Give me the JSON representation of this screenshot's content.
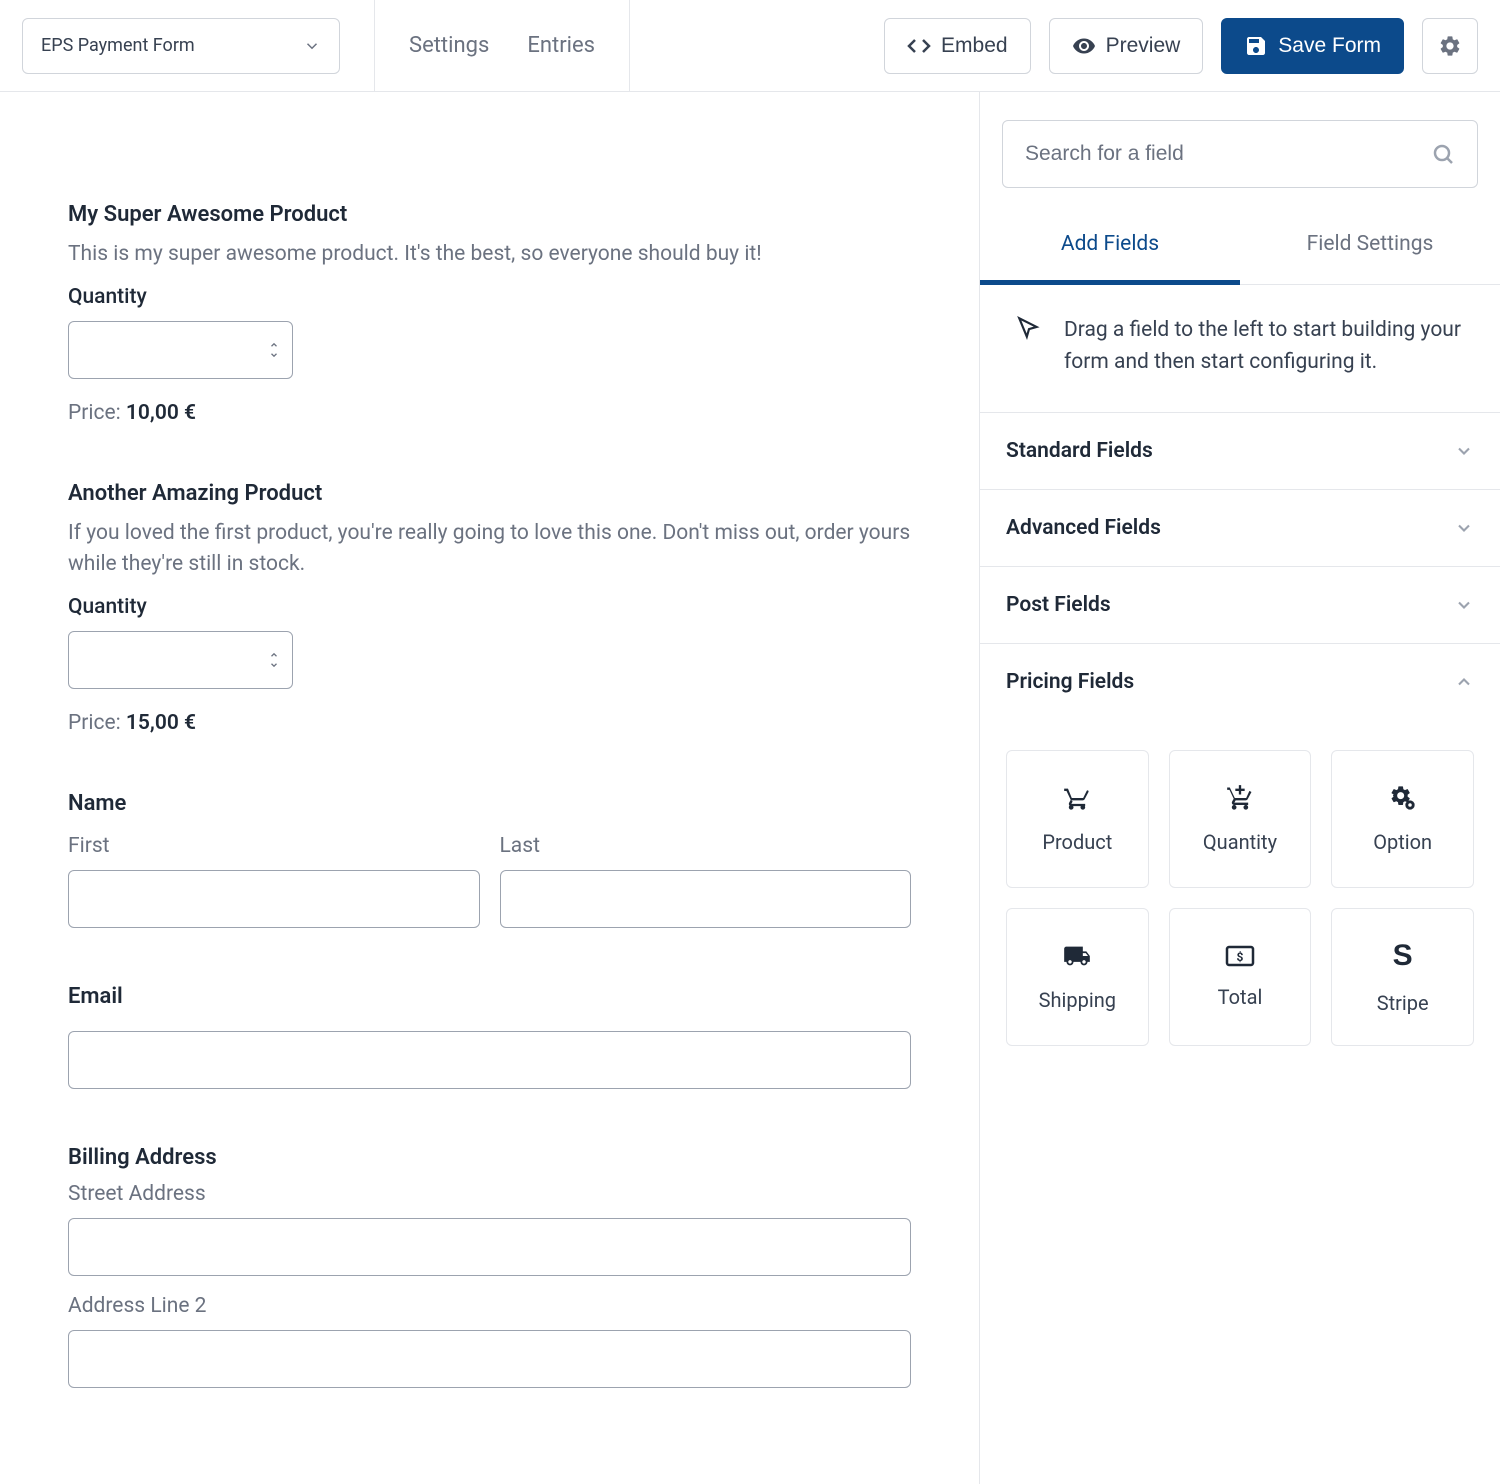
{
  "header": {
    "form_name": "EPS Payment Form",
    "nav": {
      "settings": "Settings",
      "entries": "Entries"
    },
    "buttons": {
      "embed": "Embed",
      "preview": "Preview",
      "save": "Save Form"
    }
  },
  "canvas": {
    "product1": {
      "title": "My Super Awesome Product",
      "desc": "This is my super awesome product. It's the best, so everyone should buy it!",
      "qty_label": "Quantity",
      "price_label": "Price: ",
      "price_value": "10,00 €"
    },
    "product2": {
      "title": "Another Amazing Product",
      "desc": "If you loved the first product, you're really going to love this one. Don't miss out, order yours while they're still in stock.",
      "qty_label": "Quantity",
      "price_label": "Price: ",
      "price_value": "15,00 €"
    },
    "name": {
      "label": "Name",
      "first": "First",
      "last": "Last"
    },
    "email": {
      "label": "Email"
    },
    "billing": {
      "label": "Billing Address",
      "street": "Street Address",
      "line2": "Address Line 2"
    }
  },
  "sidebar": {
    "search_placeholder": "Search for a field",
    "tabs": {
      "add": "Add Fields",
      "settings": "Field Settings"
    },
    "hint": "Drag a field to the left to start building your form and then start configuring it.",
    "sections": {
      "standard": "Standard Fields",
      "advanced": "Advanced Fields",
      "post": "Post Fields",
      "pricing": "Pricing Fields"
    },
    "pricing_items": {
      "product": "Product",
      "quantity": "Quantity",
      "option": "Option",
      "shipping": "Shipping",
      "total": "Total",
      "stripe": "Stripe"
    }
  }
}
